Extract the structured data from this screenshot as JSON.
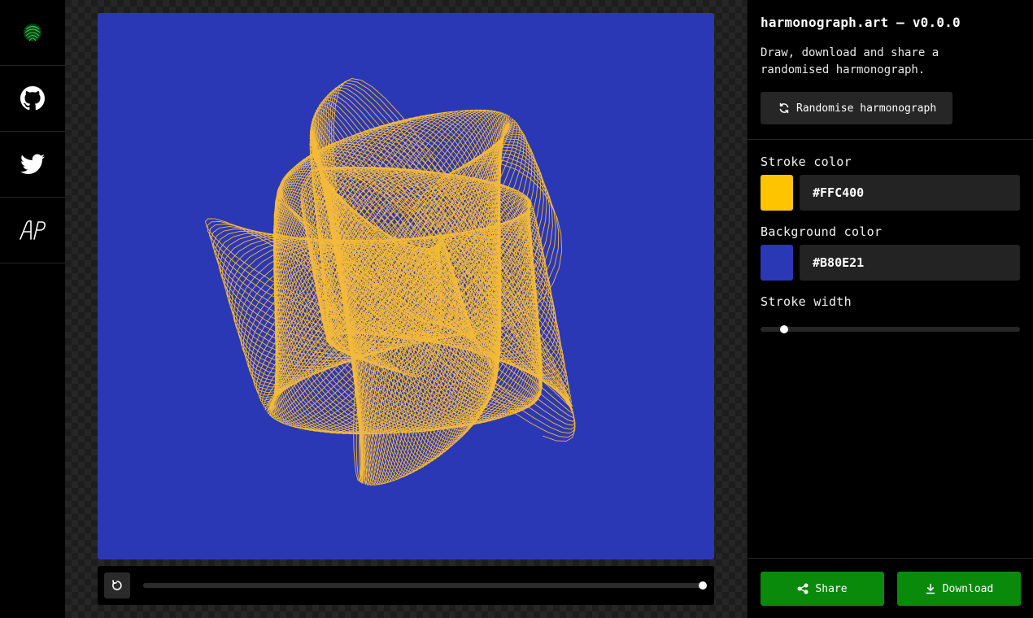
{
  "nav": {
    "items": [
      {
        "icon": "fingerprint-logo-icon",
        "color": "#1fbf3a"
      },
      {
        "icon": "github-icon"
      },
      {
        "icon": "twitter-icon"
      },
      {
        "icon": "author-monogram-icon"
      }
    ]
  },
  "canvas": {
    "background_color": "#2B38B5",
    "stroke_color": "#F2B93A"
  },
  "playback": {
    "progress": 1.0
  },
  "panel": {
    "title": "harmonograph.art – v0.0.0",
    "description": "Draw, download and share a randomised harmonograph.",
    "randomise_label": "Randomise harmonograph",
    "stroke_color_label": "Stroke color",
    "stroke_color_value": "#FFC400",
    "stroke_color_swatch": "#FFC400",
    "background_color_label": "Background color",
    "background_color_value": "#B80E21",
    "background_color_swatch": "#2B38B5",
    "stroke_width_label": "Stroke width",
    "stroke_width_fraction": 0.09,
    "share_label": "Share",
    "download_label": "Download",
    "accent_color": "#0a8a0a"
  }
}
